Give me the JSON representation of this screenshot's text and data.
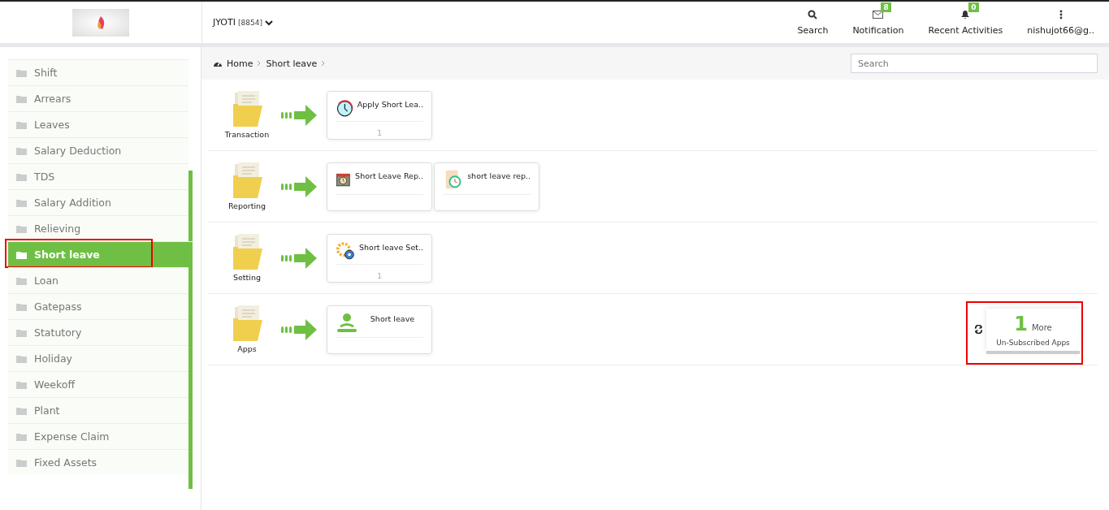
{
  "header": {
    "user": "JYOTI",
    "user_code": "[8854]",
    "actions": [
      {
        "kind": "search",
        "label": "Search"
      },
      {
        "kind": "mail",
        "label": "Notification",
        "badge": "8"
      },
      {
        "kind": "bell",
        "label": "Recent Activities",
        "badge": "0"
      },
      {
        "kind": "dots",
        "label": "nishujot66@g.."
      }
    ]
  },
  "sidebar": {
    "items": [
      {
        "label": "Shift",
        "selected": false,
        "highlighted": false
      },
      {
        "label": "Arrears",
        "selected": false,
        "highlighted": false
      },
      {
        "label": "Leaves",
        "selected": false,
        "highlighted": false
      },
      {
        "label": "Salary Deduction",
        "selected": false,
        "highlighted": false
      },
      {
        "label": "TDS",
        "selected": false,
        "highlighted": false
      },
      {
        "label": "Salary Addition",
        "selected": false,
        "highlighted": false
      },
      {
        "label": "Relieving",
        "selected": false,
        "highlighted": false
      },
      {
        "label": "Short leave",
        "selected": true,
        "highlighted": true
      },
      {
        "label": "Loan",
        "selected": false,
        "highlighted": false
      },
      {
        "label": "Gatepass",
        "selected": false,
        "highlighted": false
      },
      {
        "label": "Statutory",
        "selected": false,
        "highlighted": false
      },
      {
        "label": "Holiday",
        "selected": false,
        "highlighted": false
      },
      {
        "label": "Weekoff",
        "selected": false,
        "highlighted": false
      },
      {
        "label": "Plant",
        "selected": false,
        "highlighted": false
      },
      {
        "label": "Expense Claim",
        "selected": false,
        "highlighted": false
      },
      {
        "label": "Fixed Assets",
        "selected": false,
        "highlighted": false
      }
    ]
  },
  "breadcrumb": [
    "Home",
    "Short leave"
  ],
  "search": {
    "placeholder": "Search"
  },
  "sections": [
    {
      "label": "Transaction",
      "apps": [
        {
          "kind": "clock",
          "title": "Apply Short Lea..",
          "count": "1"
        }
      ]
    },
    {
      "label": "Reporting",
      "apps": [
        {
          "kind": "calendar",
          "title": "Short Leave Rep.."
        },
        {
          "kind": "scroll",
          "title": "short leave rep.."
        }
      ]
    },
    {
      "label": "Setting",
      "apps": [
        {
          "kind": "gears",
          "title": "Short leave Set..",
          "count": "1"
        }
      ]
    },
    {
      "label": "Apps",
      "apps": [
        {
          "kind": "person",
          "title": "Short leave"
        }
      ]
    }
  ],
  "more_apps": {
    "count": "1",
    "word": "More",
    "label": "Un-Subscribed Apps",
    "highlighted": true
  }
}
